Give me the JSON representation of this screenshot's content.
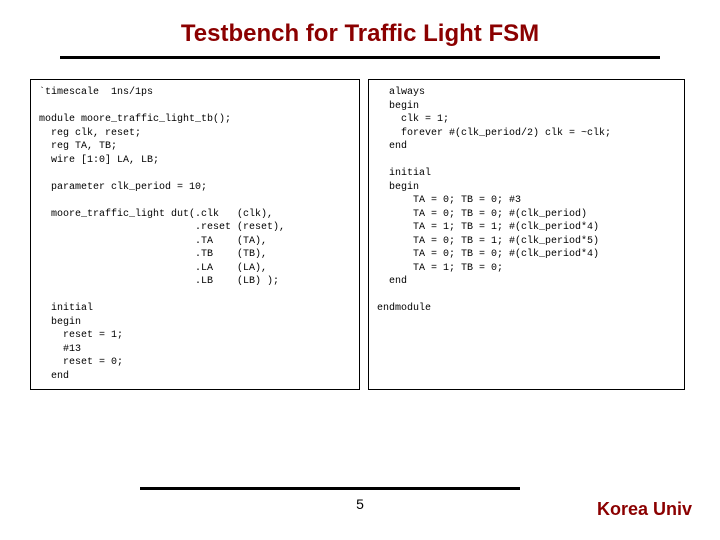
{
  "title": "Testbench for Traffic Light FSM",
  "code_left": "`timescale  1ns/1ps\n\nmodule moore_traffic_light_tb();\n  reg clk, reset;\n  reg TA, TB;\n  wire [1:0] LA, LB;\n\n  parameter clk_period = 10;\n\n  moore_traffic_light dut(.clk   (clk),\n                          .reset (reset),\n                          .TA    (TA),\n                          .TB    (TB),\n                          .LA    (LA),\n                          .LB    (LB) );\n\n  initial\n  begin\n    reset = 1;\n    #13\n    reset = 0;\n  end",
  "code_right": "  always\n  begin\n    clk = 1;\n    forever #(clk_period/2) clk = ~clk;\n  end\n\n  initial\n  begin\n      TA = 0; TB = 0; #3\n      TA = 0; TB = 0; #(clk_period)\n      TA = 1; TB = 1; #(clk_period*4)\n      TA = 0; TB = 1; #(clk_period*5)\n      TA = 0; TB = 0; #(clk_period*4)\n      TA = 1; TB = 0;\n  end\n\nendmodule",
  "page_number": "5",
  "brand": "Korea Univ"
}
